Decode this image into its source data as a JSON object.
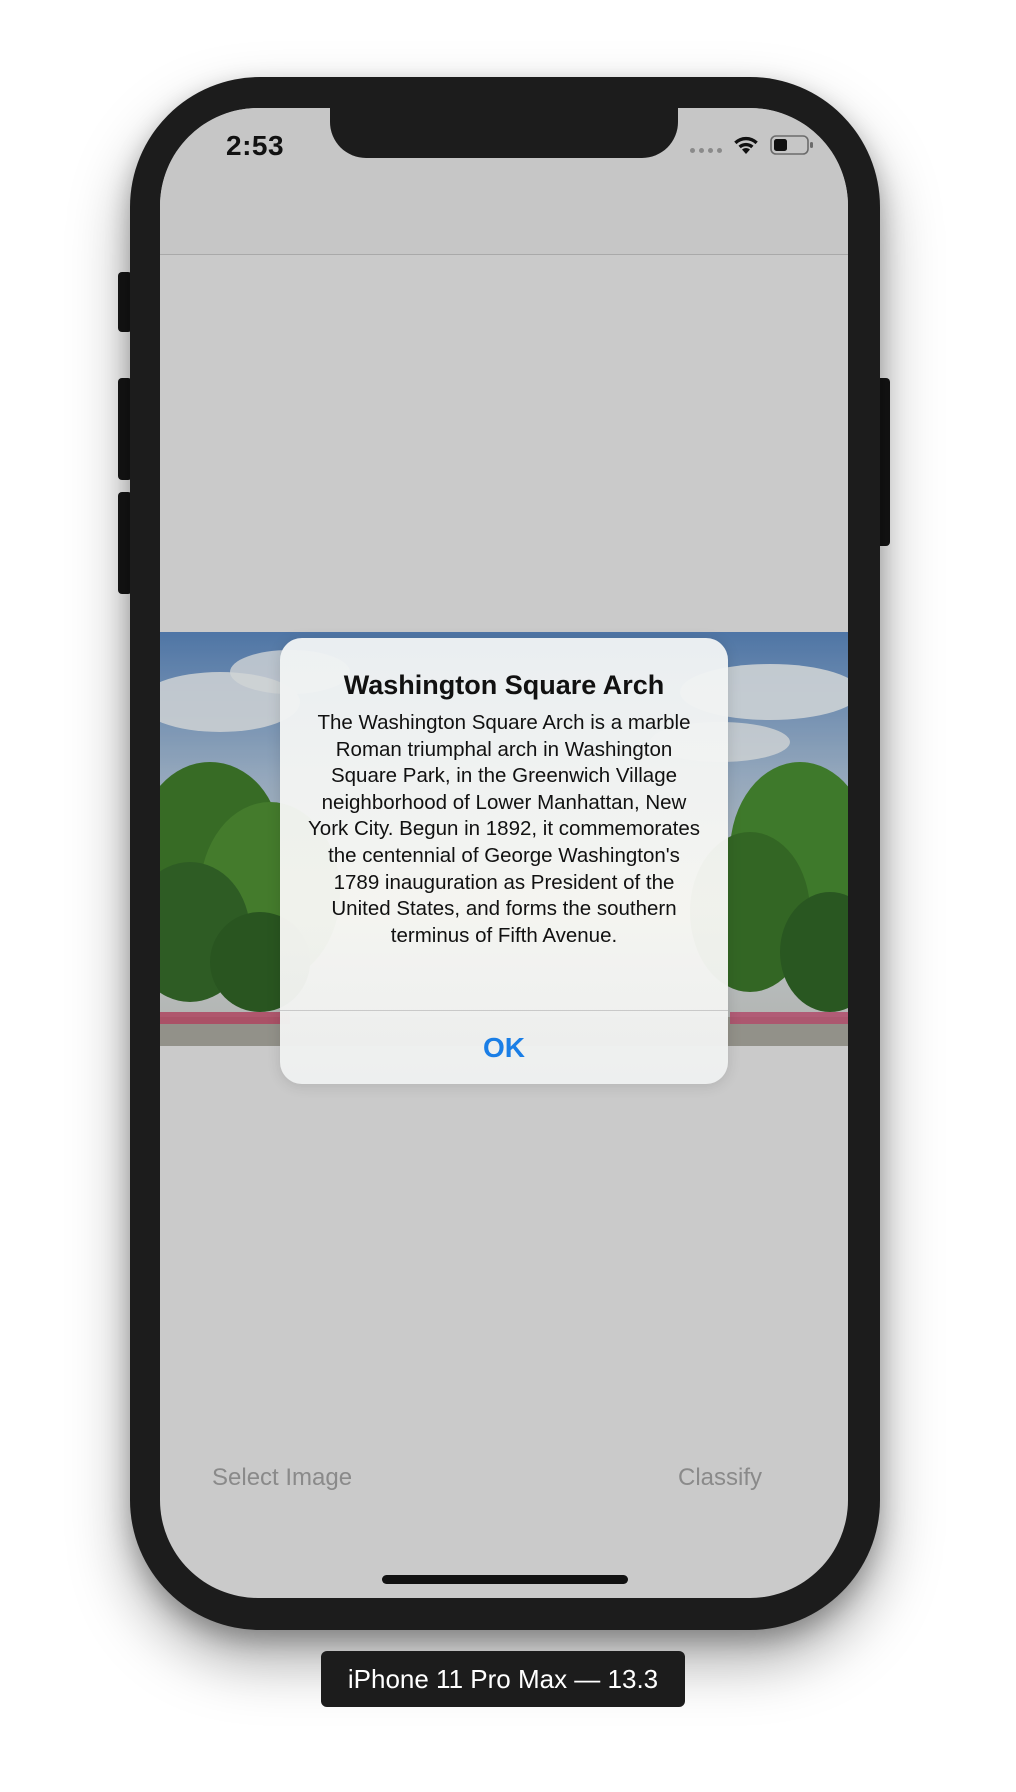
{
  "status_bar": {
    "time": "2:53",
    "signal_icon": "signal-dots-icon",
    "wifi_icon": "wifi-icon",
    "battery_icon": "battery-icon"
  },
  "photo": {
    "subject_icon": "washington-square-arch-photo"
  },
  "alert": {
    "title": "Washington Square Arch",
    "message": "The Washington Square Arch is a marble Roman triumphal arch in Washington Square Park, in the Greenwich Village neighborhood of Lower Manhattan, New York City. Begun in 1892, it commemorates the centennial of George Washington's 1789 inauguration as President of the United States, and forms the southern terminus of Fifth Avenue.",
    "ok_label": "OK"
  },
  "toolbar": {
    "select_image_label": "Select Image",
    "classify_label": "Classify"
  },
  "device": {
    "label": "iPhone 11 Pro Max — 13.3"
  },
  "colors": {
    "accent": "#1a7ee6",
    "dimmed_background": "#cacaca",
    "bezel": "#1c1c1c"
  }
}
